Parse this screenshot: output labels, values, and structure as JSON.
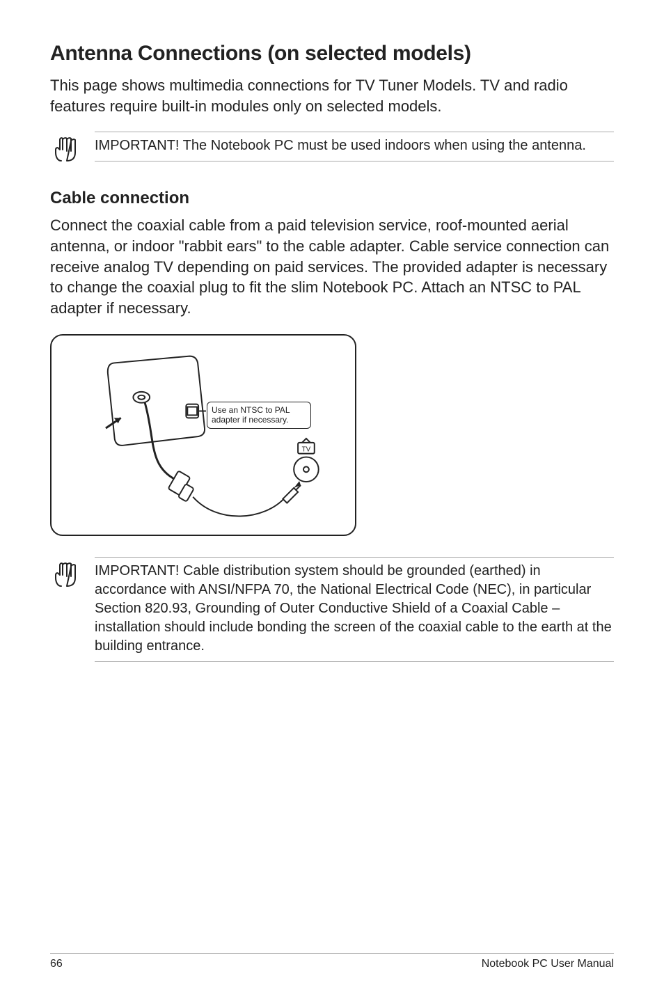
{
  "page": {
    "heading": "Antenna Connections (on selected models)",
    "intro": "This page shows multimedia connections for TV Tuner Models. TV and radio features require built-in modules only on selected models.",
    "note1": "IMPORTANT! The Notebook PC must be used indoors when using the antenna.",
    "subheading": "Cable connection",
    "cable_body": "Connect the coaxial cable from a paid television service, roof-mounted aerial antenna, or indoor \"rabbit ears\" to the cable adapter. Cable service connection can receive analog TV depending on paid services. The provided adapter is necessary to change the coaxial plug to fit the slim Notebook PC. Attach an NTSC to PAL adapter if necessary.",
    "adapter_label": "Use an NTSC to PAL adapter if necessary.",
    "note2": "IMPORTANT!  Cable distribution system should be grounded (earthed) in accordance with ANSI/NFPA 70, the National Electrical Code (NEC), in particular Section 820.93, Grounding of Outer Conductive Shield of a Coaxial Cable – installation should include bonding the screen of the coaxial cable to the earth at the building entrance."
  },
  "footer": {
    "page_number": "66",
    "manual_title": "Notebook PC User Manual"
  }
}
